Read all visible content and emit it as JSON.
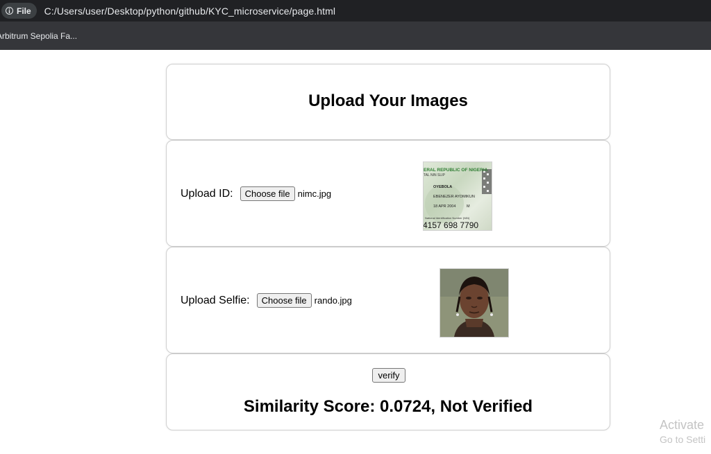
{
  "browser": {
    "scheme_label": "File",
    "url": "C:/Users/user/Desktop/python/github/KYC_microservice/page.html",
    "bookmarks": [
      {
        "label": "Arbitrum Sepolia Fa..."
      }
    ]
  },
  "page": {
    "title": "Upload Your Images",
    "id_upload": {
      "label": "Upload ID:",
      "button": "Choose file",
      "filename": "nimc.jpg",
      "preview": {
        "header": "ERAL REPUBLIC OF NIGERIA",
        "subheader": "TAL NIN SLIP",
        "surname": "OYEBOLA",
        "given_names": "EBENEZER AYOMIKUN",
        "dob": "18 APR 2004",
        "sex": "M",
        "nin_label": "National Identification Number (NIN)",
        "nin": "4157 698 7790"
      }
    },
    "selfie_upload": {
      "label": "Upload Selfie:",
      "button": "Choose file",
      "filename": "rando.jpg"
    },
    "verify_button": "verify",
    "result": "Similarity Score: 0.0724, Not Verified"
  },
  "os_watermark": {
    "line1": "Activate",
    "line2": "Go to Setti"
  },
  "colors": {
    "urlbar_bg": "#202124",
    "bookmarks_bg": "#35363a",
    "chrome_text": "#e8eaed",
    "card_border": "#cfcfcf"
  },
  "icons": {
    "scheme": "info-icon"
  }
}
